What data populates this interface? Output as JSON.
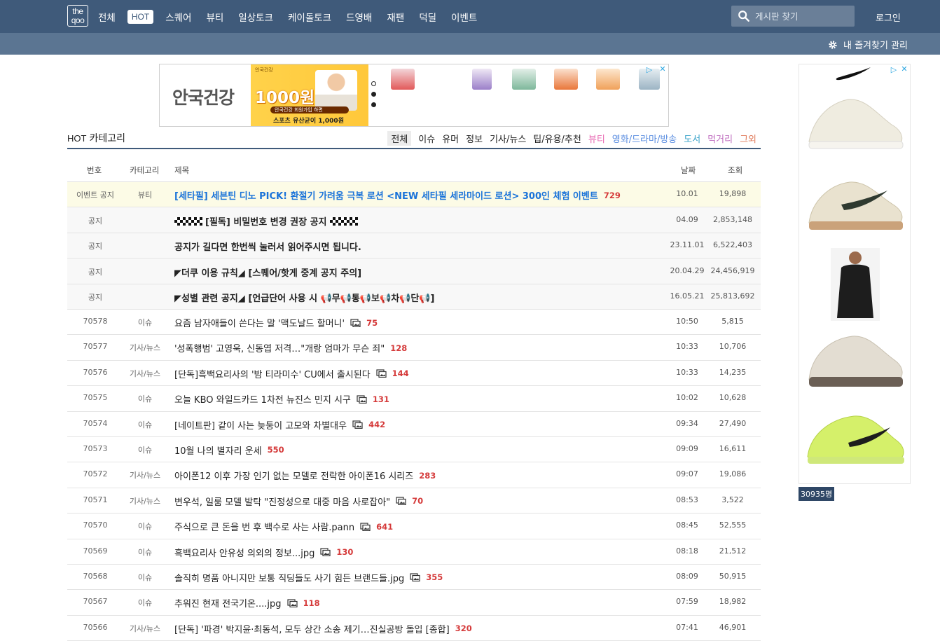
{
  "logo": "the qoo",
  "nav": {
    "items": [
      "전체",
      "HOT",
      "스퀘어",
      "뷰티",
      "일상토크",
      "케이돌토크",
      "드영배",
      "재팬",
      "덕딜",
      "이벤트"
    ],
    "search_placeholder": "게시판 찾기",
    "login_label": "로그인",
    "favorites_label": "내 즐겨찾기 관리"
  },
  "ad_top": {
    "brand": "안국건강",
    "small_text": "안국건강",
    "price": "1000원",
    "sub1": "안국건강 회원가입 하면",
    "sub2": "스포츠 유산균이 1,000원"
  },
  "visitors": "30935명",
  "board": {
    "hot_label": "HOT",
    "category_label": "카테고리",
    "categories": [
      {
        "label": "전체",
        "color": "#222222",
        "active": true
      },
      {
        "label": "이슈",
        "color": "#222222"
      },
      {
        "label": "유머",
        "color": "#222222"
      },
      {
        "label": "정보",
        "color": "#222222"
      },
      {
        "label": "기사/뉴스",
        "color": "#222222"
      },
      {
        "label": "팁/유용/추천",
        "color": "#222222"
      },
      {
        "label": "뷰티",
        "color": "#e86ab3"
      },
      {
        "label": "영화/드라마/방송",
        "color": "#5a8de0"
      },
      {
        "label": "도서",
        "color": "#3aa3c9"
      },
      {
        "label": "먹거리",
        "color": "#c06fc0"
      },
      {
        "label": "그외",
        "color": "#e07a5a"
      }
    ],
    "columns": {
      "no": "번호",
      "category": "카테고리",
      "title": "제목",
      "date": "날짜",
      "views": "조회"
    },
    "rows": [
      {
        "no": "이벤트 공지",
        "cat": "뷰티",
        "title": "[세타필] 세븐틴 디노 PICK! 환절기 가려움 극복 로션 <NEW 세타필 세라마이드 로션> 300인 체험 이벤트",
        "comments": "729",
        "img": false,
        "date": "10.01",
        "views": "19,898",
        "type": "event"
      },
      {
        "no": "공지",
        "cat": "",
        "title": "[필독] 비밀번호 변경 권장 공지",
        "comments": "",
        "img": false,
        "date": "04.09",
        "views": "2,853,148",
        "type": "notice",
        "checker": true
      },
      {
        "no": "공지",
        "cat": "",
        "title": "공지가 길다면 한번씩 눌러서 읽어주시면 됩니다.",
        "comments": "",
        "img": false,
        "date": "23.11.01",
        "views": "6,522,403",
        "type": "notice"
      },
      {
        "no": "공지",
        "cat": "",
        "title": "◤더쿠 이용 규칙◢ [스퀘어/핫게 중계 공지 주의]",
        "comments": "",
        "img": false,
        "date": "20.04.29",
        "views": "24,456,919",
        "type": "notice"
      },
      {
        "no": "공지",
        "cat": "",
        "title": "◤성별 관련 공지◢ [언급단어 사용 시 📢무📢통📢보📢차📢단📢]",
        "comments": "",
        "img": false,
        "date": "16.05.21",
        "views": "25,813,692",
        "type": "notice"
      },
      {
        "no": "70578",
        "cat": "이슈",
        "title": "요즘 남자애들이 쓴다는 말 '맥도날드 할머니'",
        "comments": "75",
        "img": true,
        "date": "10:50",
        "views": "5,815",
        "type": "normal"
      },
      {
        "no": "70577",
        "cat": "기사/뉴스",
        "title": "'성폭행범' 고영욱, 신동엽 저격…\"개랑 엄마가 무슨 죄\"",
        "comments": "128",
        "img": false,
        "date": "10:33",
        "views": "10,706",
        "type": "normal"
      },
      {
        "no": "70576",
        "cat": "기사/뉴스",
        "title": "[단독]흑백요리사의 '밤 티라미수' CU에서 출시된다",
        "comments": "144",
        "img": true,
        "date": "10:33",
        "views": "14,235",
        "type": "normal"
      },
      {
        "no": "70575",
        "cat": "이슈",
        "title": "오늘 KBO 와일드카드 1차전 뉴진스 민지 시구",
        "comments": "131",
        "img": true,
        "date": "10:02",
        "views": "10,628",
        "type": "normal"
      },
      {
        "no": "70574",
        "cat": "이슈",
        "title": "[네이트판] 같이 사는 늦둥이 고모와 차별대우",
        "comments": "442",
        "img": true,
        "date": "09:34",
        "views": "27,490",
        "type": "normal"
      },
      {
        "no": "70573",
        "cat": "이슈",
        "title": "10월 나의 별자리 운세",
        "comments": "550",
        "img": false,
        "date": "09:09",
        "views": "16,611",
        "type": "normal"
      },
      {
        "no": "70572",
        "cat": "기사/뉴스",
        "title": "아이폰12 이후 가장 인기 없는 모델로 전락한 아이폰16 시리즈",
        "comments": "283",
        "img": false,
        "date": "09:07",
        "views": "19,086",
        "type": "normal"
      },
      {
        "no": "70571",
        "cat": "기사/뉴스",
        "title": "변우석, 일룸 모델 발탁 \"진정성으로 대중 마음 사로잡아\"",
        "comments": "70",
        "img": true,
        "date": "08:53",
        "views": "3,522",
        "type": "normal"
      },
      {
        "no": "70570",
        "cat": "이슈",
        "title": "주식으로 큰 돈을 번 후 백수로 사는 사람.pann",
        "comments": "641",
        "img": true,
        "date": "08:45",
        "views": "52,555",
        "type": "normal"
      },
      {
        "no": "70569",
        "cat": "이슈",
        "title": "흑백요리사 안유성 의외의 정보...jpg",
        "comments": "130",
        "img": true,
        "date": "08:18",
        "views": "21,512",
        "type": "normal"
      },
      {
        "no": "70568",
        "cat": "이슈",
        "title": "솔직히 명품 아니지만 보통 직딩들도 사기 힘든 브랜드들.jpg",
        "comments": "355",
        "img": true,
        "date": "08:09",
        "views": "50,915",
        "type": "normal"
      },
      {
        "no": "70567",
        "cat": "이슈",
        "title": "추워진 현재 전국기온....jpg",
        "comments": "118",
        "img": true,
        "date": "07:59",
        "views": "18,982",
        "type": "normal"
      },
      {
        "no": "70566",
        "cat": "기사/뉴스",
        "title": "[단독] '파경' 박지윤·최동석, 모두 상간 소송 제기…진실공방 돌입 [종합]",
        "comments": "320",
        "img": false,
        "date": "07:41",
        "views": "46,901",
        "type": "normal"
      }
    ]
  }
}
